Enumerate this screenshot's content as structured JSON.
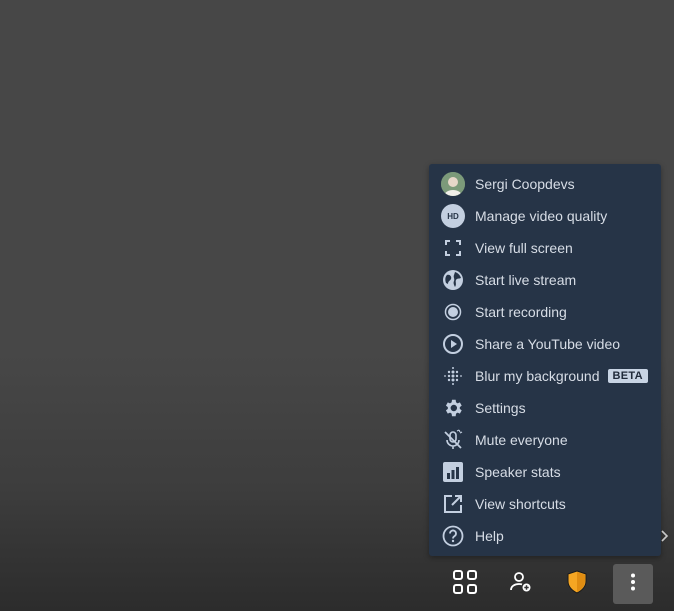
{
  "menu": {
    "items": [
      {
        "label": "Sergi Coopdevs",
        "icon": "avatar"
      },
      {
        "label": "Manage video quality",
        "icon": "hd-icon",
        "icon_text": "HD"
      },
      {
        "label": "View full screen",
        "icon": "fullscreen-icon"
      },
      {
        "label": "Start live stream",
        "icon": "globe-icon"
      },
      {
        "label": "Start recording",
        "icon": "record-icon"
      },
      {
        "label": "Share a YouTube video",
        "icon": "play-circle-icon"
      },
      {
        "label": "Blur my background",
        "icon": "blur-icon",
        "badge": "BETA"
      },
      {
        "label": "Settings",
        "icon": "gear-icon"
      },
      {
        "label": "Mute everyone",
        "icon": "mic-off-icon"
      },
      {
        "label": "Speaker stats",
        "icon": "bar-chart-icon"
      },
      {
        "label": "View shortcuts",
        "icon": "external-link-icon"
      },
      {
        "label": "Help",
        "icon": "help-icon"
      }
    ]
  },
  "toolbar": {
    "buttons": [
      {
        "name": "tile-view",
        "icon": "grid-icon"
      },
      {
        "name": "invite",
        "icon": "add-person-icon"
      },
      {
        "name": "security",
        "icon": "shield-icon"
      },
      {
        "name": "more",
        "icon": "more-vertical-icon"
      }
    ]
  },
  "colors": {
    "menu_bg": "#263447",
    "menu_text": "#d7dde6",
    "icon": "#c3cfe0",
    "shield": "#f5a623"
  }
}
